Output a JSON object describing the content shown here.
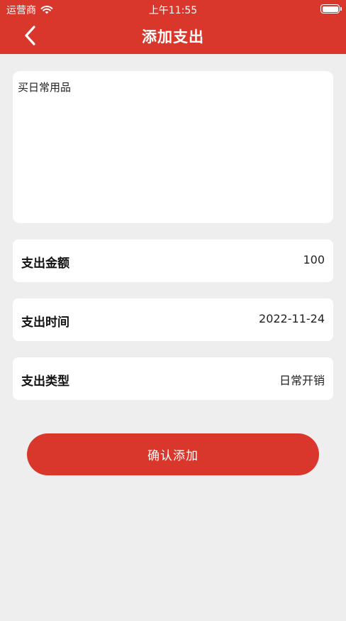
{
  "status_bar": {
    "carrier": "运营商",
    "time": "上午11:55"
  },
  "nav": {
    "title": "添加支出",
    "back_icon": "chevron-left-icon"
  },
  "note": {
    "text": "买日常用品"
  },
  "fields": [
    {
      "label": "支出金额",
      "value": "100"
    },
    {
      "label": "支出时间",
      "value": "2022-11-24"
    },
    {
      "label": "支出类型",
      "value": "日常开销"
    }
  ],
  "confirm_button": {
    "label": "确认添加"
  },
  "colors": {
    "accent": "#d9372c",
    "background": "#efeeee",
    "card": "#ffffff"
  }
}
